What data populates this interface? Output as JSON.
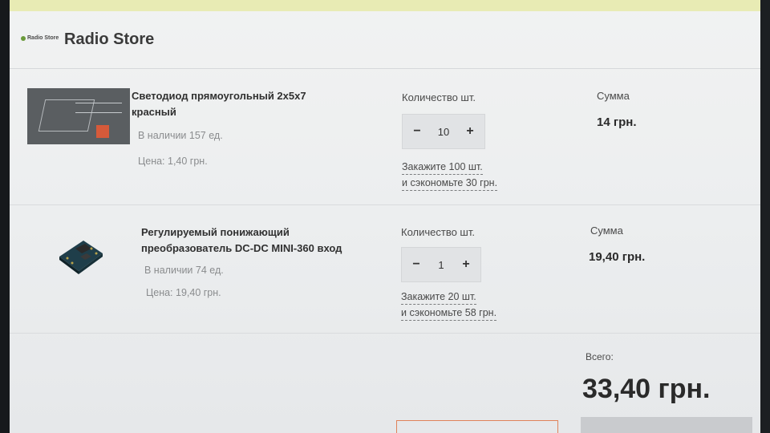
{
  "header": {
    "logo_text": "Radio Store",
    "title": "Radio Store"
  },
  "items": [
    {
      "name_line1": "Светодиод прямоугольный 2x5x7",
      "name_line2": "красный",
      "stock": "В наличии 157 ед.",
      "price": "Цена: 1,40 грн.",
      "qty_label": "Количество шт.",
      "qty_minus": "−",
      "qty_value": "10",
      "qty_plus": "+",
      "promo_line1": "Закажите 100 шт.",
      "promo_line2": "и сэкономьте 30 грн.",
      "sum_label": "Сумма",
      "sum_value": "14 грн."
    },
    {
      "name_line1": "Регулируемый понижающий",
      "name_line2": "преобразователь DC-DC MINI-360 вход",
      "stock": "В наличии 74 ед.",
      "price": "Цена: 19,40 грн.",
      "qty_label": "Количество шт.",
      "qty_minus": "−",
      "qty_value": "1",
      "qty_plus": "+",
      "promo_line1": "Закажите 20 шт.",
      "promo_line2": "и сэкономьте 58 грн.",
      "sum_label": "Сумма",
      "sum_value": "19,40 грн."
    }
  ],
  "total": {
    "label": "Всего:",
    "value": "33,40 грн."
  },
  "colors": {
    "accent_orange": "#e0825a",
    "led_red": "#d65a3a",
    "top_band": "#e8ebb4"
  }
}
